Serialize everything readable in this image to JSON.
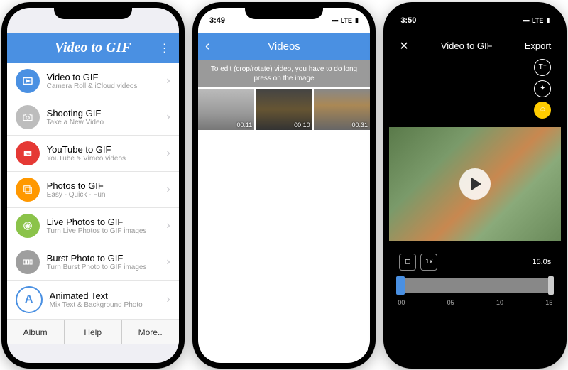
{
  "phone1": {
    "app_title": "Video to GIF",
    "menu": [
      {
        "title": "Video to GIF",
        "sub": "Camera Roll & iCloud videos",
        "color": "#4a90e2",
        "icon": "play"
      },
      {
        "title": "Shooting GIF",
        "sub": "Take a New Video",
        "color": "#bdbdbd",
        "icon": "camera"
      },
      {
        "title": "YouTube to GIF",
        "sub": "YouTube & Vimeo videos",
        "color": "#e53935",
        "icon": "youtube"
      },
      {
        "title": "Photos to GIF",
        "sub": "Easy - Quick - Fun",
        "color": "#ff9800",
        "icon": "photos"
      },
      {
        "title": "Live Photos to GIF",
        "sub": "Turn Live Photos to GIF images",
        "color": "#8bc34a",
        "icon": "live"
      },
      {
        "title": "Burst Photo to GIF",
        "sub": "Turn Burst Photo to GIF images",
        "color": "#9e9e9e",
        "icon": "burst"
      },
      {
        "title": "Animated Text",
        "sub": "Mix Text & Background Photo",
        "color": "#4a90e2",
        "icon": "text"
      }
    ],
    "bottom": [
      "Album",
      "Help",
      "More.."
    ]
  },
  "phone2": {
    "status_time": "3:49",
    "status_net": "LTE",
    "header": "Videos",
    "hint": "To edit (crop/rotate) video, you have to do long press on the image",
    "thumbs": [
      {
        "dur": "00:11"
      },
      {
        "dur": "00:10"
      },
      {
        "dur": "00:31"
      }
    ]
  },
  "phone3": {
    "status_time": "3:50",
    "status_net": "LTE",
    "title": "Video to GIF",
    "export": "Export",
    "duration": "15.0s",
    "speed": "1x",
    "ticks": [
      "00",
      "05",
      "10",
      "15"
    ]
  }
}
